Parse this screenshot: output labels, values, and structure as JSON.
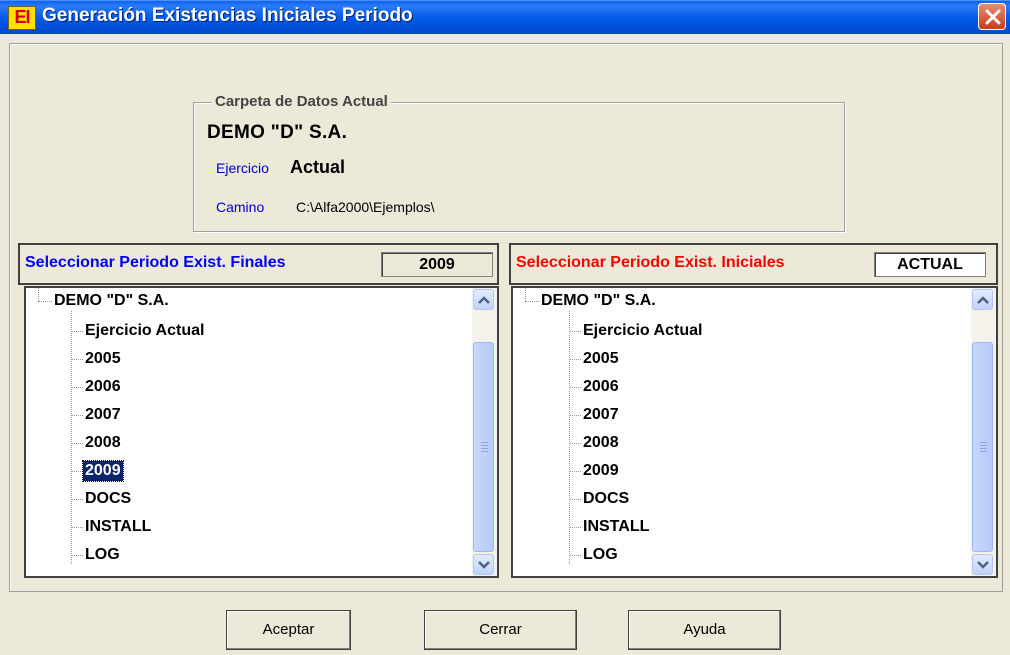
{
  "window": {
    "icon_text": "EI",
    "title": "Generación Existencias Iniciales Periodo"
  },
  "carpeta": {
    "legend": "Carpeta de Datos Actual",
    "company": "DEMO \"D\" S.A.",
    "ejercicio_label": "Ejercicio",
    "ejercicio_value": "Actual",
    "camino_label": "Camino",
    "camino_value": "C:\\Alfa2000\\Ejemplos\\"
  },
  "left_panel": {
    "label": "Seleccionar Periodo Exist. Finales",
    "label_color": "#0000FF",
    "value": "2009",
    "root": "DEMO \"D\" S.A.",
    "items": [
      "Ejercicio Actual",
      "2005",
      "2006",
      "2007",
      "2008",
      "2009",
      "DOCS",
      "INSTALL",
      "LOG"
    ],
    "selected": "2009"
  },
  "right_panel": {
    "label": "Seleccionar Periodo Exist. Iniciales",
    "label_color": "#FF0000",
    "value": "ACTUAL",
    "root": "DEMO \"D\" S.A.",
    "items": [
      "Ejercicio Actual",
      "2005",
      "2006",
      "2007",
      "2008",
      "2009",
      "DOCS",
      "INSTALL",
      "LOG"
    ]
  },
  "buttons": {
    "accept": "Aceptar",
    "close": "Cerrar",
    "help": "Ayuda"
  },
  "colors": {
    "title_bar": "#0058E6",
    "dialog_bg": "#ECE9D8",
    "selection": "#0A246A"
  }
}
